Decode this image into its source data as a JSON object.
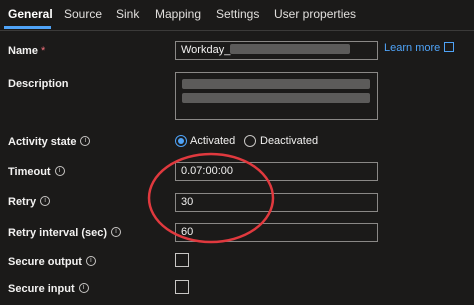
{
  "tabs": [
    "General",
    "Source",
    "Sink",
    "Mapping",
    "Settings",
    "User properties"
  ],
  "fields": {
    "name_label": "Name",
    "required_marker": "*",
    "name_value": "Workday_",
    "learn_more": "Learn more",
    "description_label": "Description",
    "activity_state_label": "Activity state",
    "activated_label": "Activated",
    "deactivated_label": "Deactivated",
    "activity_state_selected": "Activated",
    "timeout_label": "Timeout",
    "timeout_value": "0.07:00:00",
    "retry_label": "Retry",
    "retry_value": "30",
    "retry_interval_label": "Retry interval (sec)",
    "retry_interval_value": "60",
    "secure_output_label": "Secure output",
    "secure_output_checked": false,
    "secure_input_label": "Secure input",
    "secure_input_checked": false
  },
  "info_glyph": "i",
  "colors": {
    "accent": "#4fa3f7",
    "highlight_ellipse": "#e0393e",
    "background": "#1b1a19"
  }
}
